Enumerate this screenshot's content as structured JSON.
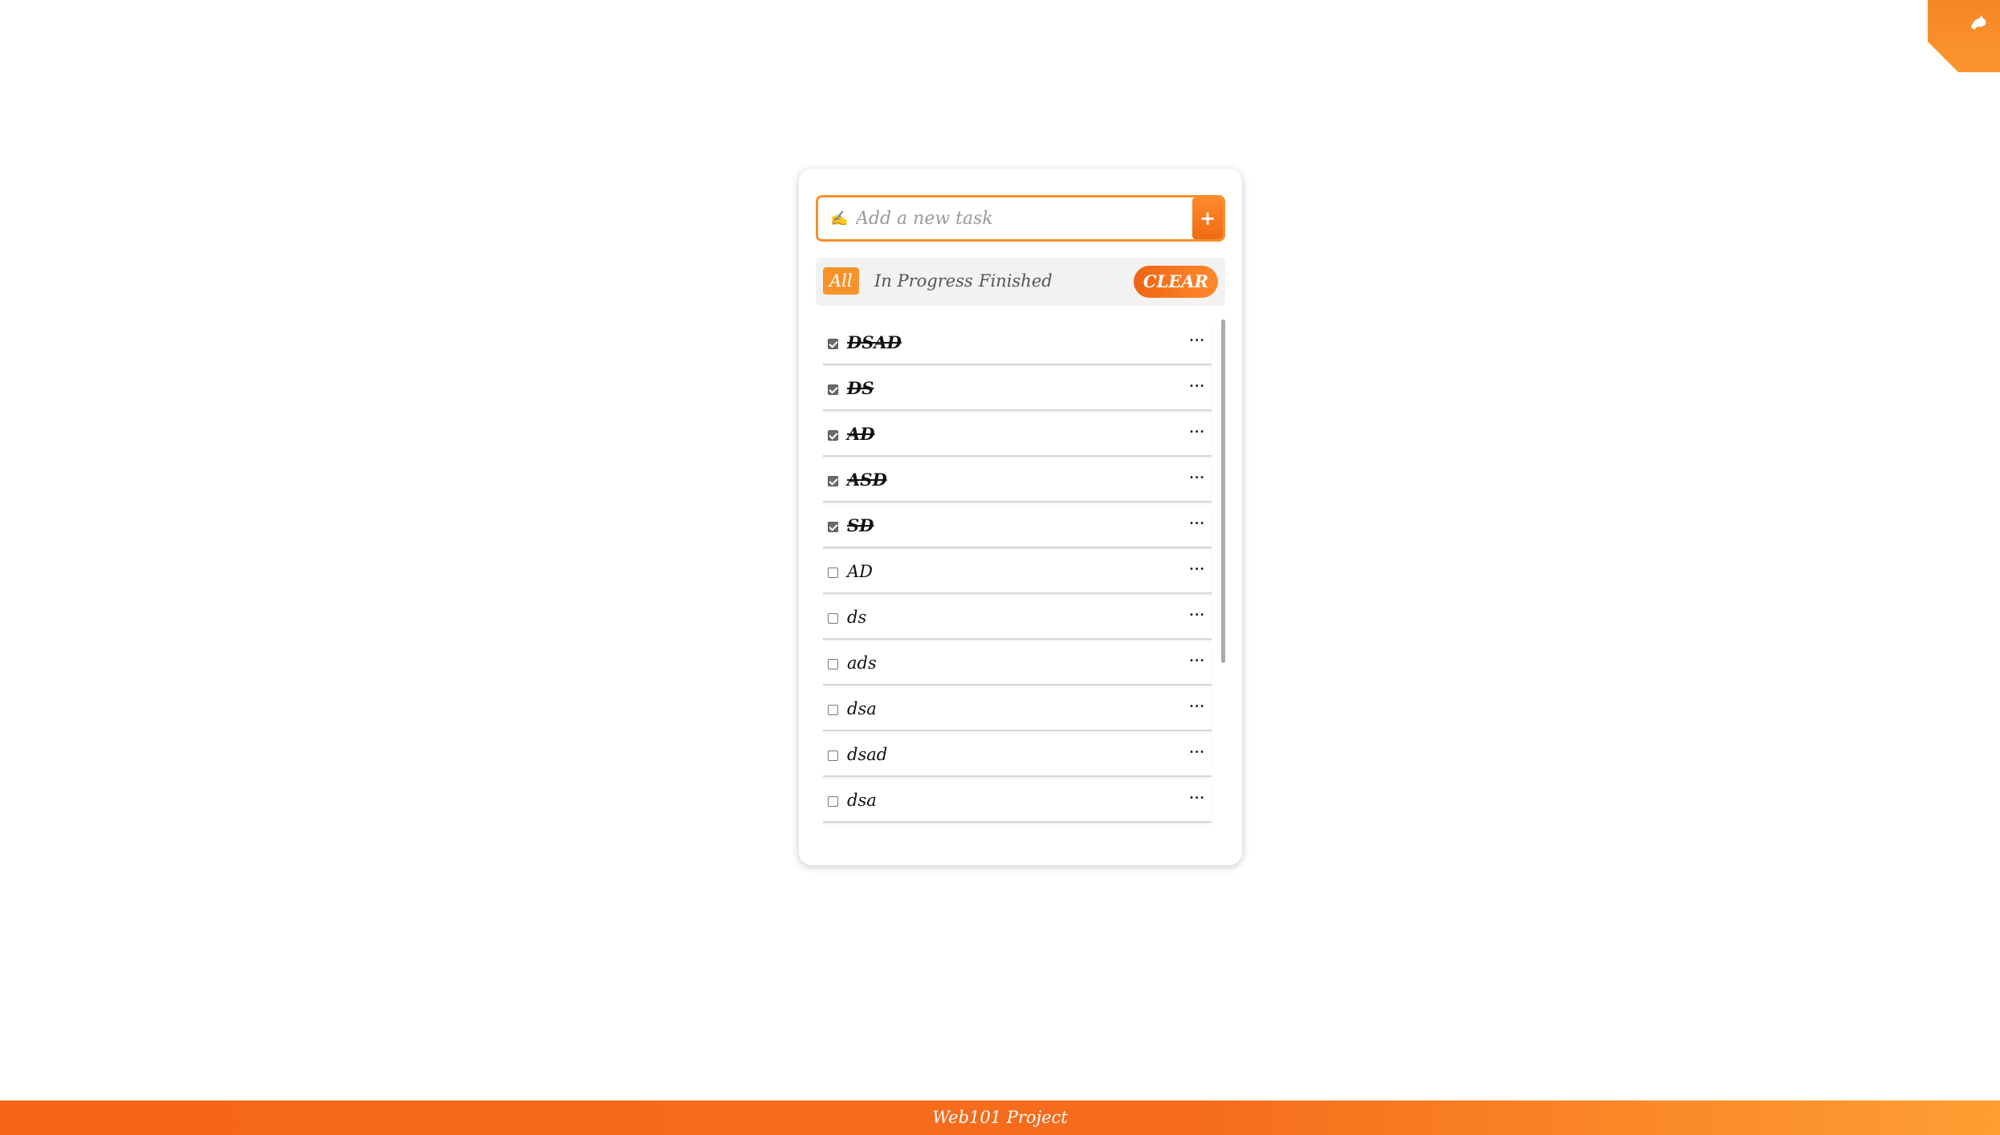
{
  "corner": {
    "icon": "github-cat-icon"
  },
  "input": {
    "icon": "writing-hand-icon",
    "placeholder": "Add a new task",
    "add_label": "+"
  },
  "filters": {
    "tabs": [
      {
        "label": "All",
        "active": true
      },
      {
        "label": "In Progress",
        "active": false
      },
      {
        "label": "Finished",
        "active": false
      }
    ],
    "clear_label": "CLEAR"
  },
  "tasks": [
    {
      "label": "DSAD",
      "done": true,
      "menu": "···"
    },
    {
      "label": "DS",
      "done": true,
      "menu": "···"
    },
    {
      "label": "AD",
      "done": true,
      "menu": "···"
    },
    {
      "label": "ASD",
      "done": true,
      "menu": "···"
    },
    {
      "label": "SD",
      "done": true,
      "menu": "···"
    },
    {
      "label": "AD",
      "done": false,
      "menu": "···"
    },
    {
      "label": "ds",
      "done": false,
      "menu": "···"
    },
    {
      "label": "ads",
      "done": false,
      "menu": "···"
    },
    {
      "label": "dsa",
      "done": false,
      "menu": "···"
    },
    {
      "label": "dsad",
      "done": false,
      "menu": "···"
    },
    {
      "label": "dsa",
      "done": false,
      "menu": "···"
    }
  ],
  "footer": {
    "text": "Web101 Project"
  },
  "colors": {
    "accent": "#f7932b",
    "accent_dark": "#f06414"
  }
}
